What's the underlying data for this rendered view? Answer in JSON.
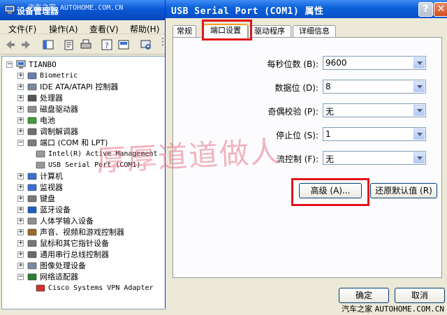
{
  "device_manager": {
    "title": "设备管理器",
    "title_watermark": "汽车之家 AUTOHOME.COM.CN",
    "menu": [
      "文件(F)",
      "操作(A)",
      "查看(V)",
      "帮助(H)"
    ],
    "tree": {
      "root": "TIANBO",
      "nodes": [
        {
          "label": "Biometric",
          "level": 1,
          "expand": "+",
          "icon": "biometric-icon"
        },
        {
          "label": "IDE ATA/ATAPI 控制器",
          "level": 1,
          "expand": "+",
          "icon": "ide-controller-icon"
        },
        {
          "label": "处理器",
          "level": 1,
          "expand": "+",
          "icon": "processor-icon"
        },
        {
          "label": "磁盘驱动器",
          "level": 1,
          "expand": "+",
          "icon": "disk-drive-icon"
        },
        {
          "label": "电池",
          "level": 1,
          "expand": "+",
          "icon": "battery-icon"
        },
        {
          "label": "调制解调器",
          "level": 1,
          "expand": "+",
          "icon": "modem-icon"
        },
        {
          "label": "端口 (COM 和 LPT)",
          "level": 1,
          "expand": "-",
          "icon": "port-icon"
        },
        {
          "label": "Intel(R) Active Management",
          "level": 2,
          "expand": "",
          "icon": "port-device-icon"
        },
        {
          "label": "USB Serial Port (COM1)",
          "level": 2,
          "expand": "",
          "icon": "port-device-icon"
        },
        {
          "label": "计算机",
          "level": 1,
          "expand": "+",
          "icon": "computer-icon"
        },
        {
          "label": "监视器",
          "level": 1,
          "expand": "+",
          "icon": "monitor-icon"
        },
        {
          "label": "键盘",
          "level": 1,
          "expand": "+",
          "icon": "keyboard-icon"
        },
        {
          "label": "蓝牙设备",
          "level": 1,
          "expand": "+",
          "icon": "bluetooth-icon"
        },
        {
          "label": "人体学输入设备",
          "level": 1,
          "expand": "+",
          "icon": "hid-icon"
        },
        {
          "label": "声音、视频和游戏控制器",
          "level": 1,
          "expand": "+",
          "icon": "sound-icon"
        },
        {
          "label": "鼠标和其它指针设备",
          "level": 1,
          "expand": "+",
          "icon": "mouse-icon"
        },
        {
          "label": "通用串行总线控制器",
          "level": 1,
          "expand": "+",
          "icon": "usb-icon"
        },
        {
          "label": "图像处理设备",
          "level": 1,
          "expand": "+",
          "icon": "imaging-icon"
        },
        {
          "label": "网络适配器",
          "level": 1,
          "expand": "-",
          "icon": "network-adapter-icon"
        },
        {
          "label": "Cisco Systems VPN Adapter",
          "level": 2,
          "expand": "",
          "icon": "network-card-icon"
        }
      ]
    }
  },
  "dialog": {
    "title": "USB Serial Port (COM1) 属性",
    "tabs": [
      "常规",
      "端口设置",
      "驱动程序",
      "详细信息"
    ],
    "active_tab": "端口设置",
    "settings": [
      {
        "label": "每秒位数 (B):",
        "value": "9600"
      },
      {
        "label": "数据位 (D):",
        "value": "8"
      },
      {
        "label": "奇偶校验 (P):",
        "value": "无"
      },
      {
        "label": "停止位 (S):",
        "value": "1"
      },
      {
        "label": "流控制 (F):",
        "value": "无"
      }
    ],
    "advanced_label": "高级 (A)...",
    "restore_label": "还原默认值 (R)",
    "ok_label": "确定",
    "cancel_label": "取消"
  },
  "overlay": {
    "watermark": "厚厚道道做人",
    "bottom_cn": "汽车之家",
    "bottom_en": "AUTOHOME.COM.CN"
  },
  "colors": {
    "highlight": "#e0141a",
    "titlebar": "#0a5fd8",
    "tab_accent": "#f5a02b"
  }
}
